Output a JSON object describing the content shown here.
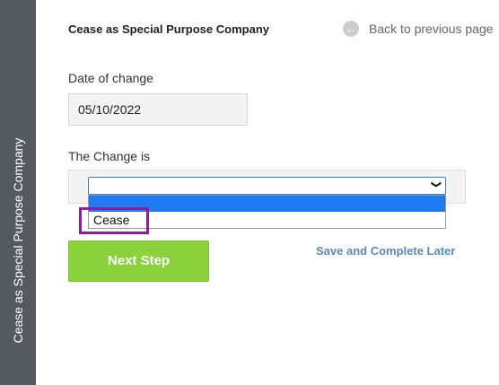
{
  "sidebar": {
    "label": "Cease as Special Purpose Company"
  },
  "header": {
    "title": "Cease as Special Purpose Company",
    "back_label": "Back to previous page",
    "back_icon": "arrow-left-circle-icon"
  },
  "form": {
    "date_label": "Date of change",
    "date_value": "05/10/2022",
    "change_label": "The Change is",
    "change_selected": "",
    "change_options": [
      "",
      "Cease"
    ]
  },
  "actions": {
    "next_label": "Next Step",
    "save_later_label": "Save and Complete Later"
  },
  "colors": {
    "sidebar_bg": "#555a60",
    "next_button_bg": "#8cd23c",
    "link_color": "#5a8bb5",
    "highlight_outline": "#8a1f9b",
    "option_highlight": "#1e7bf2"
  }
}
